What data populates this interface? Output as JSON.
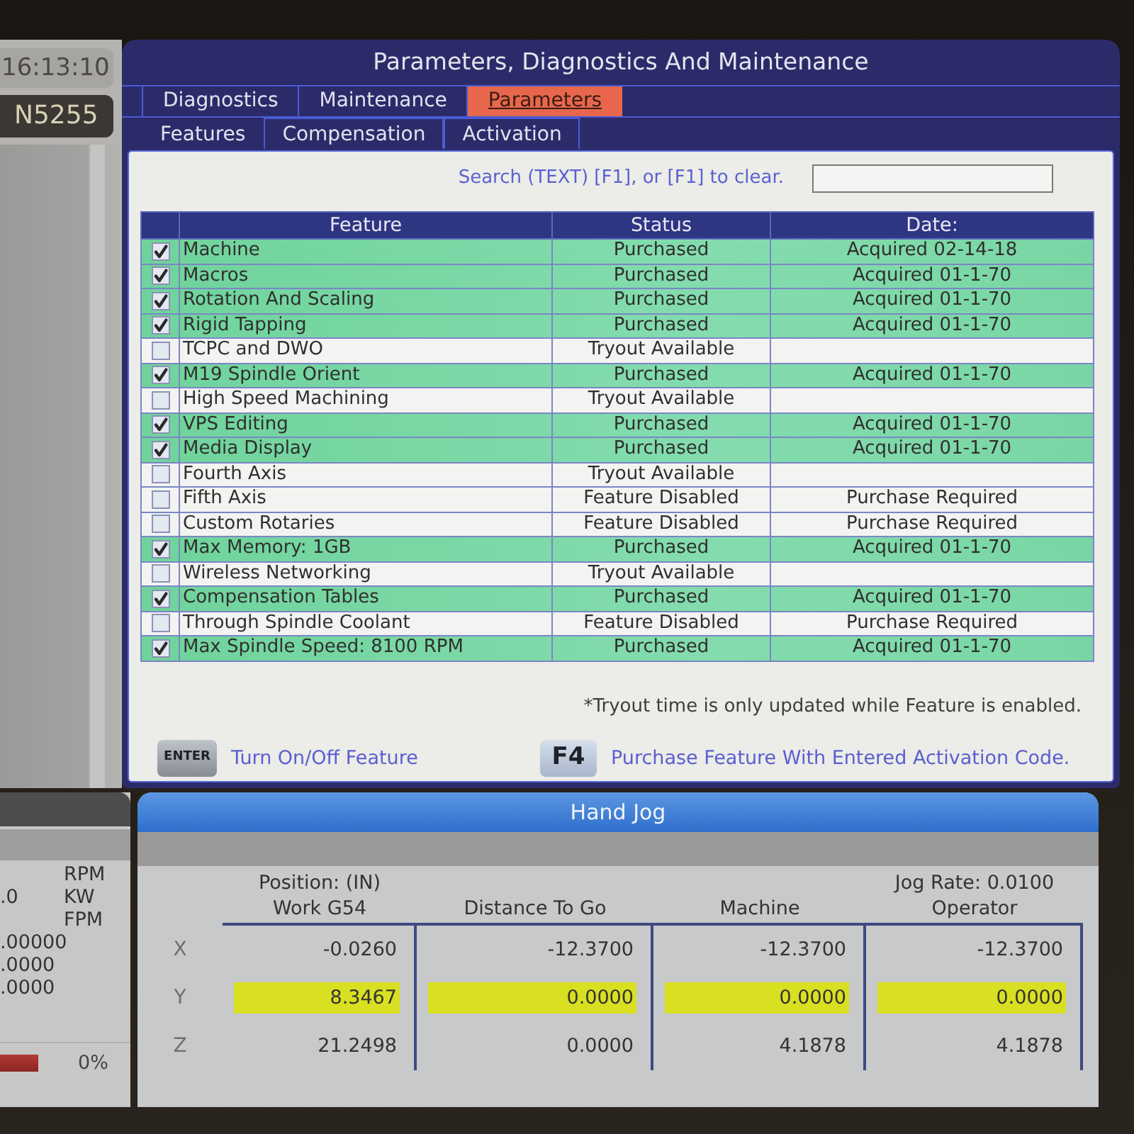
{
  "status_panel": {
    "clock": "16:13:10",
    "line_number": "N5255"
  },
  "window": {
    "title": "Parameters, Diagnostics And Maintenance"
  },
  "tabs": [
    {
      "label": "Diagnostics",
      "selected": false
    },
    {
      "label": "Maintenance",
      "selected": false
    },
    {
      "label": "Parameters",
      "selected": true
    }
  ],
  "subtabs": [
    {
      "label": "Features",
      "selected": true
    },
    {
      "label": "Compensation",
      "selected": false
    },
    {
      "label": "Activation",
      "selected": false
    }
  ],
  "search": {
    "label": "Search (TEXT) [F1], or [F1] to clear."
  },
  "table": {
    "columns": [
      "Feature",
      "Status",
      "Date:"
    ],
    "rows": [
      {
        "checked": true,
        "feature": "Machine",
        "status": "Purchased",
        "date": "Acquired 02-14-18"
      },
      {
        "checked": true,
        "feature": "Macros",
        "status": "Purchased",
        "date": "Acquired 01-1-70"
      },
      {
        "checked": true,
        "feature": "Rotation And Scaling",
        "status": "Purchased",
        "date": "Acquired 01-1-70"
      },
      {
        "checked": true,
        "feature": "Rigid Tapping",
        "status": "Purchased",
        "date": "Acquired 01-1-70"
      },
      {
        "checked": false,
        "feature": "TCPC and DWO",
        "status": "Tryout Available"
      },
      {
        "checked": true,
        "feature": "M19 Spindle Orient",
        "status": "Purchased",
        "date": "Acquired 01-1-70"
      },
      {
        "checked": false,
        "feature": "High Speed Machining",
        "status": "Tryout Available"
      },
      {
        "checked": true,
        "feature": "VPS Editing",
        "status": "Purchased",
        "date": "Acquired 01-1-70"
      },
      {
        "checked": true,
        "feature": "Media Display",
        "status": "Purchased",
        "date": "Acquired 01-1-70"
      },
      {
        "checked": false,
        "feature": "Fourth Axis",
        "status": "Tryout Available"
      },
      {
        "checked": false,
        "feature": "Fifth Axis",
        "status": "Feature Disabled",
        "date": "Purchase Required"
      },
      {
        "checked": false,
        "feature": "Custom Rotaries",
        "status": "Feature Disabled",
        "date": "Purchase Required"
      },
      {
        "checked": true,
        "feature": "Max Memory: 1GB",
        "status": "Purchased",
        "date": "Acquired 01-1-70"
      },
      {
        "checked": false,
        "feature": "Wireless Networking",
        "status": "Tryout Available"
      },
      {
        "checked": true,
        "feature": "Compensation Tables",
        "status": "Purchased",
        "date": "Acquired 01-1-70"
      },
      {
        "checked": false,
        "feature": "Through Spindle Coolant",
        "status": "Feature Disabled",
        "date": "Purchase Required"
      },
      {
        "checked": true,
        "feature": "Max Spindle Speed: 8100 RPM",
        "status": "Purchased",
        "date": "Acquired 01-1-70"
      }
    ]
  },
  "footnote": "*Tryout time is only updated while Feature is enabled.",
  "key_hints": [
    {
      "key": "ENTER",
      "text": "Turn On/Off Feature"
    },
    {
      "key": "F4",
      "text": "Purchase Feature With Entered Activation Code."
    }
  ],
  "spindle_panel": {
    "readouts": [
      {
        "unit": "RPM"
      },
      {
        "value": ".0",
        "unit": "KW"
      },
      {
        "unit": "FPM"
      },
      {
        "value": ".00000"
      },
      {
        "value": ".0000"
      },
      {
        "value": ".0000"
      }
    ],
    "load": "0%"
  },
  "hand_jog": {
    "title": "Hand Jog",
    "position_label": "Position: (IN)",
    "jog_rate": "Jog Rate: 0.0100",
    "columns": [
      "Work G54",
      "Distance To Go",
      "Machine",
      "Operator"
    ],
    "rows": [
      {
        "axis": "X",
        "selected": false,
        "values": [
          "-0.0260",
          "-12.3700",
          "-12.3700",
          "-12.3700"
        ]
      },
      {
        "axis": "Y",
        "selected": true,
        "values": [
          "8.3467",
          "0.0000",
          "0.0000",
          "0.0000"
        ]
      },
      {
        "axis": "Z",
        "selected": false,
        "values": [
          "21.2498",
          "0.0000",
          "4.1878",
          "4.1878"
        ]
      }
    ]
  }
}
